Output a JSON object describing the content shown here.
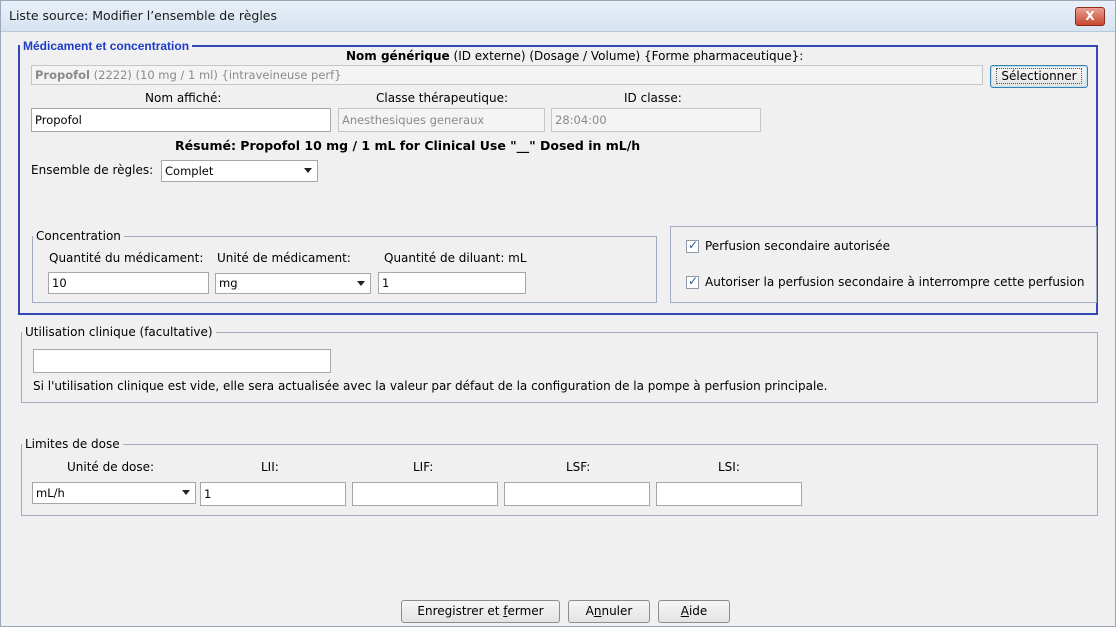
{
  "window": {
    "title": "Liste source: Modifier l’ensemble de règles",
    "close_glyph": "X"
  },
  "med": {
    "legend": "Médicament et concentration",
    "header_bold": "Nom générique",
    "header_rest": "(ID externe) (Dosage / Volume) {Forme pharmaceutique}:",
    "generic_name_bold": "Propofol",
    "generic_name_rest": "(2222) (10 mg / 1 ml) {intraveineuse perf}",
    "select_button": "Sélectionner",
    "display_name_label": "Nom affiché:",
    "display_name_value": "Propofol",
    "therapeutic_class_label": "Classe thérapeutique:",
    "therapeutic_class_value": "Anesthesiques generaux",
    "class_id_label": "ID classe:",
    "class_id_value": "28:04:00",
    "summary": "Résumé: Propofol 10 mg / 1 mL for Clinical Use \"__\" Dosed in mL/h",
    "ruleset_label": "Ensemble de règles:",
    "ruleset_value": "Complet",
    "concentration": {
      "legend": "Concentration",
      "drug_qty_label": "Quantité du médicament:",
      "drug_qty_value": "10",
      "drug_unit_label": "Unité de médicament:",
      "drug_unit_value": "mg",
      "diluent_label": "Quantité de diluant: mL",
      "diluent_value": "1"
    },
    "secondary": {
      "allowed_label": "Perfusion secondaire autorisée",
      "allowed_checked": true,
      "interrupt_label": "Autoriser la perfusion secondaire à interrompre cette perfusion",
      "interrupt_checked": true
    }
  },
  "clinical": {
    "legend": "Utilisation clinique (facultative)",
    "value": "",
    "note": "Si l'utilisation clinique est vide, elle sera actualisée avec la valeur par défaut de la configuration de la pompe à perfusion principale."
  },
  "dose": {
    "legend": "Limites de dose",
    "unit_label": "Unité de dose:",
    "unit_value": "mL/h",
    "lii_label": "LII:",
    "lii_value": "1",
    "lif_label": "LIF:",
    "lif_value": "",
    "lsf_label": "LSF:",
    "lsf_value": "",
    "lsi_label": "LSI:",
    "lsi_value": ""
  },
  "buttons": {
    "save_pre": "Enregistrer et ",
    "save_u": "f",
    "save_post": "ermer",
    "cancel_pre": "A",
    "cancel_u": "n",
    "cancel_post": "nuler",
    "help_u": "A",
    "help_post": "ide"
  }
}
